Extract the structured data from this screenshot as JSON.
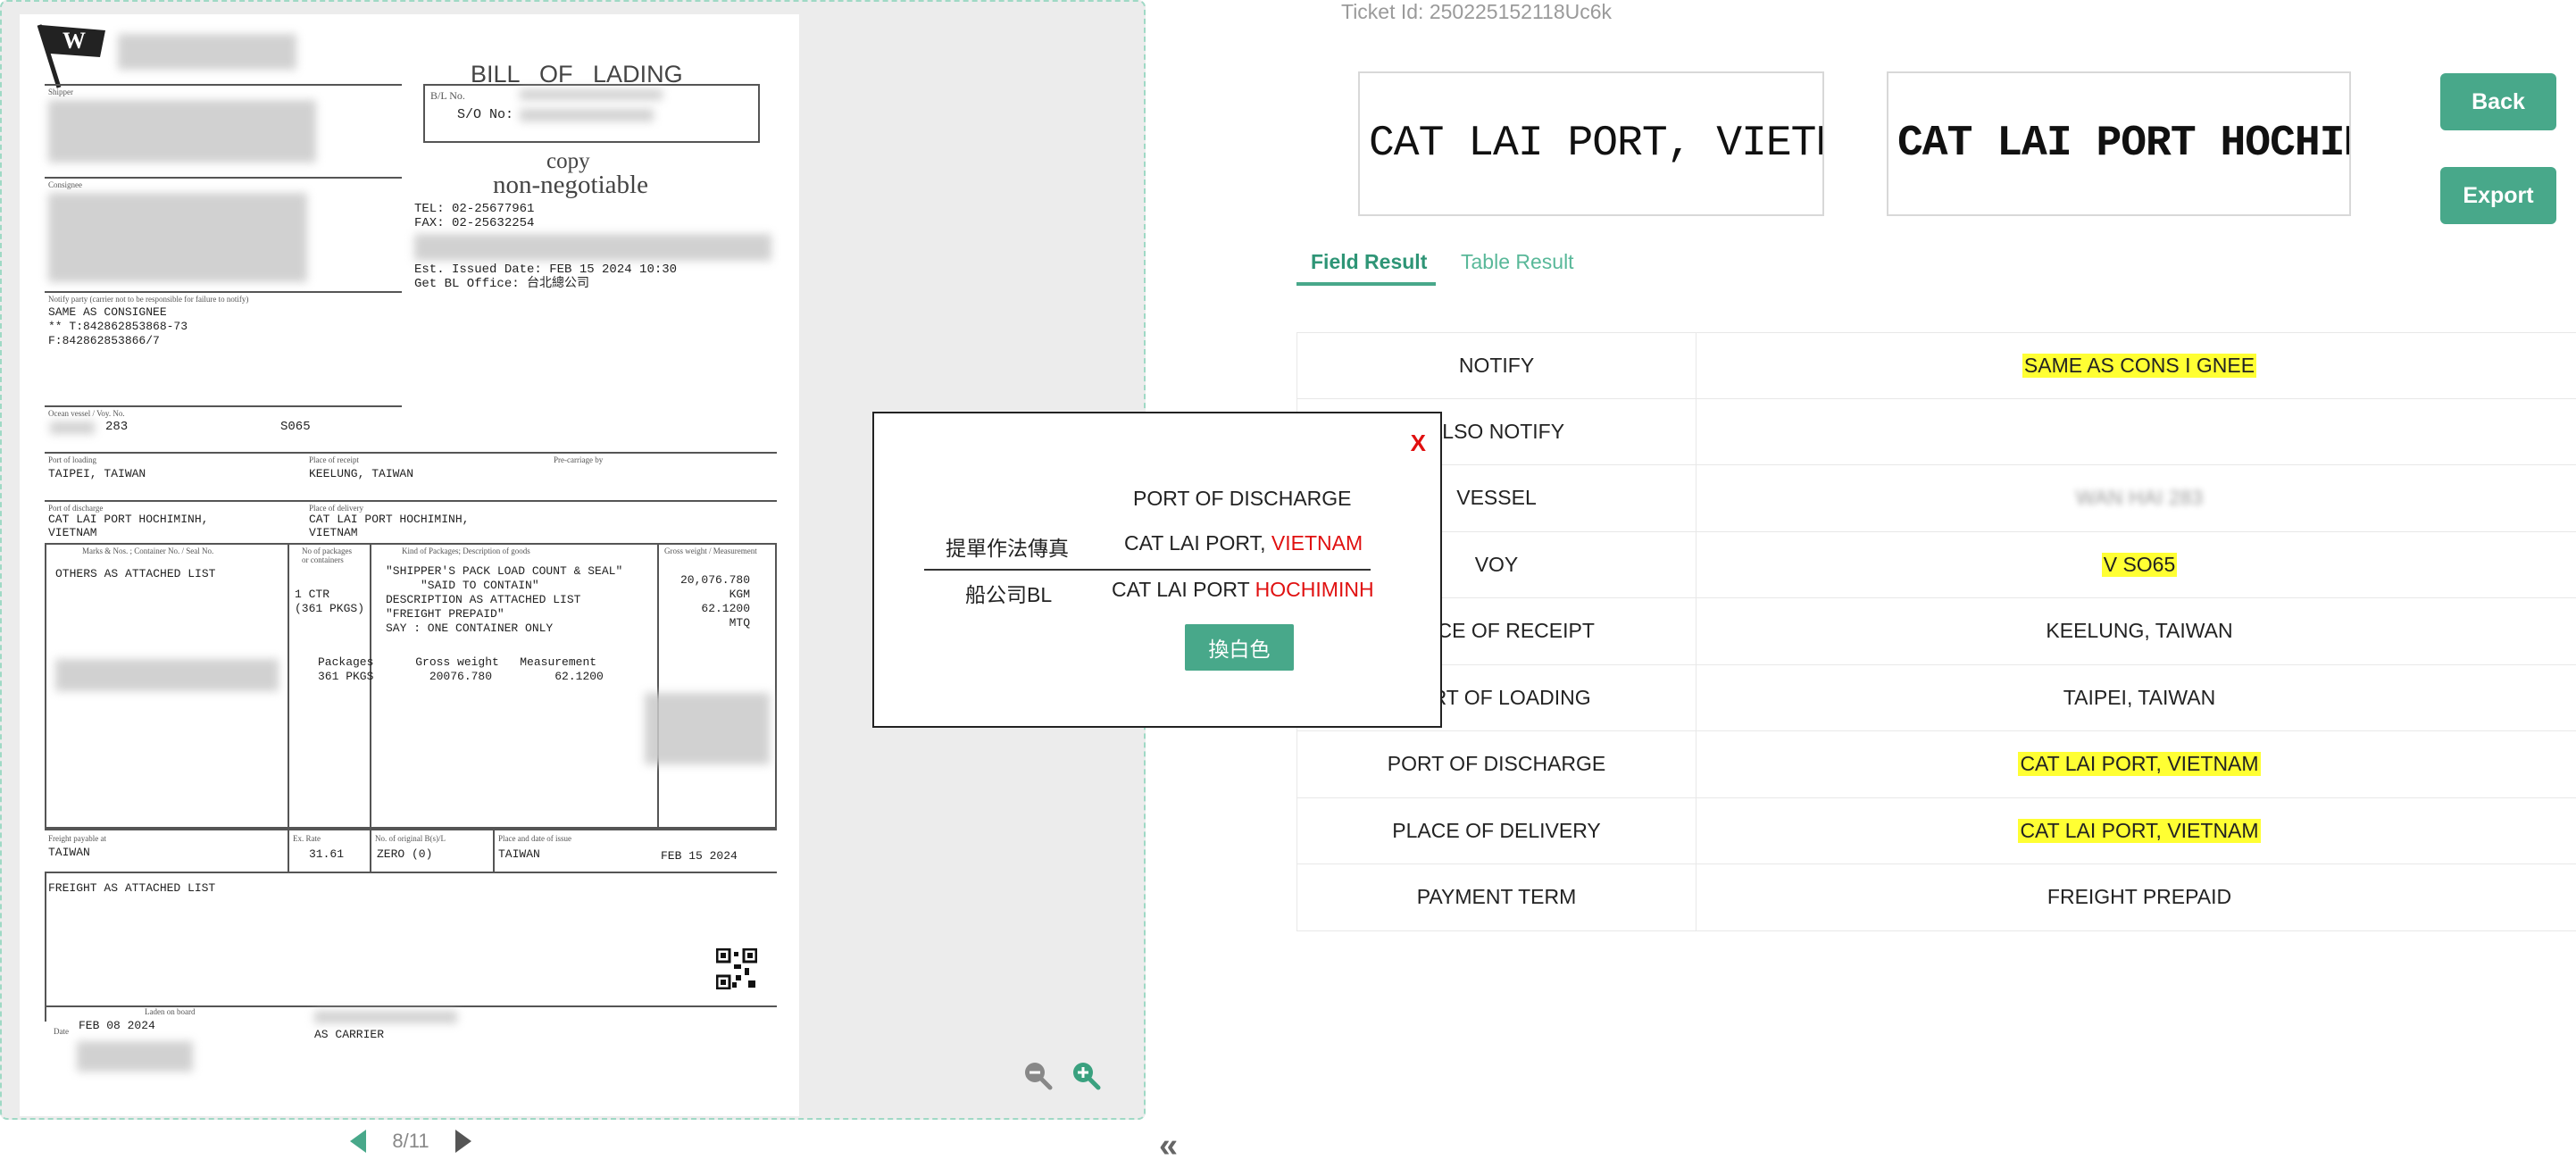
{
  "ticket_id": "Ticket Id: 250225152118Uc6k",
  "crops": {
    "left": "CAT LAI PORT, VIETNAM",
    "right": "CAT LAI PORT HOCHIMINH,"
  },
  "buttons": {
    "back": "Back",
    "export": "Export"
  },
  "tabs": {
    "field_result": "Field Result",
    "table_result": "Table Result"
  },
  "fields": [
    {
      "label": "NOTIFY",
      "value": "SAME AS CONS I GNEE",
      "highlight": true
    },
    {
      "label": "ALSO NOTIFY",
      "value": "",
      "highlight": false
    },
    {
      "label": "VESSEL",
      "value": "WAN HAI 283",
      "highlight": false,
      "blurred": true
    },
    {
      "label": "VOY",
      "value": "V SO65",
      "highlight": true
    },
    {
      "label": "PLACE OF RECEIPT",
      "value": "KEELUNG, TAIWAN",
      "highlight": false
    },
    {
      "label": "PORT OF LOADING",
      "value": "TAIPEI, TAIWAN",
      "highlight": false
    },
    {
      "label": "PORT OF DISCHARGE",
      "value": "CAT LAI PORT, VIETNAM",
      "highlight": true
    },
    {
      "label": "PLACE OF DELIVERY",
      "value": "CAT LAI PORT, VIETNAM",
      "highlight": true
    },
    {
      "label": "PAYMENT TERM",
      "value": "FREIGHT PREPAID",
      "highlight": false
    }
  ],
  "popup": {
    "close": "X",
    "header": "PORT OF DISCHARGE",
    "row1_label": "提單作法傳真",
    "row1_black": "CAT LAI PORT, ",
    "row1_v1": "VI",
    "row1_v2": "ET",
    "row1_v3": "N",
    "row1_v4": "AM",
    "row2_label": "船公司BL",
    "row2_black": "CAT LAI PORT ",
    "row2_v1": "HOCH",
    "row2_v2": "I",
    "row2_v3": "M",
    "row2_v4": "I",
    "row2_v5": "N",
    "row2_v6": "H",
    "button": "換白色"
  },
  "pager": {
    "page": "8/11"
  },
  "document": {
    "title": "BILL   OF   LADING",
    "bl_no_label": "B/L No.",
    "so_no_label": "S/O No:",
    "copy": "copy",
    "non_negotiable": "non-negotiable",
    "tel": "TEL: 02-25677961",
    "fax": "FAX: 02-25632254",
    "issued": "Est. Issued Date: FEB 15 2024 10:30",
    "office": "Get BL Office: 台北總公司",
    "shipper_label": "Shipper",
    "consignee_label": "Consignee",
    "notify_label": "Notify party  (carrier not to be responsible for failure to notify)",
    "notify_text": "SAME AS CONSIGNEE\n** T:842862853868-73\nF:842862853866/7",
    "vessel_label": "Ocean vessel / Voy. No.",
    "vessel_no": "283",
    "voy": "S065",
    "pol_label": "Port of loading",
    "pol": "TAIPEI, TAIWAN",
    "por_label": "Place of receipt",
    "por": "KEELUNG, TAIWAN",
    "precarriage_label": "Pre-carriage by",
    "pod_label": "Port of discharge",
    "pod": "CAT LAI PORT HOCHIMINH,\nVIETNAM",
    "pdel_label": "Place of delivery",
    "pdel": "CAT LAI PORT HOCHIMINH,\nVIETNAM",
    "marks_label": "Marks & Nos. ; Container No. / Seal No.",
    "marks": "OTHERS AS ATTACHED LIST",
    "pkgs_label": "No of packages\nor containers",
    "pkgs": "1 CTR\n(361 PKGS)",
    "kind_label": "Kind of Packages; Description of goods",
    "desc": "\"SHIPPER'S PACK LOAD COUNT & SEAL\"\n     \"SAID TO CONTAIN\"\nDESCRIPTION AS ATTACHED LIST\n\"FREIGHT PREPAID\"\nSAY : ONE CONTAINER ONLY",
    "totals": "Packages      Gross weight   Measurement\n361 PKGS        20076.780         62.1200",
    "gw_label": "Gross weight / Measurement",
    "gw": "20,076.780\n       KGM\n   62.1200\n       MTQ",
    "freight_at_label": "Freight payable at",
    "freight_at": "TAIWAN",
    "exrate_label": "Ex. Rate",
    "exrate": "31.61",
    "originals_label": "No. of original B(s)/L",
    "originals": "ZERO (0)",
    "place_issue_label": "Place and date of issue",
    "place_issue": "TAIWAN",
    "date_issue": "FEB 15 2024",
    "freight_list": "FREIGHT AS ATTACHED LIST",
    "laden_label": "Laden on board",
    "date_label": "Date",
    "laden_date": "FEB 08 2024",
    "carrier": "AS CARRIER"
  }
}
